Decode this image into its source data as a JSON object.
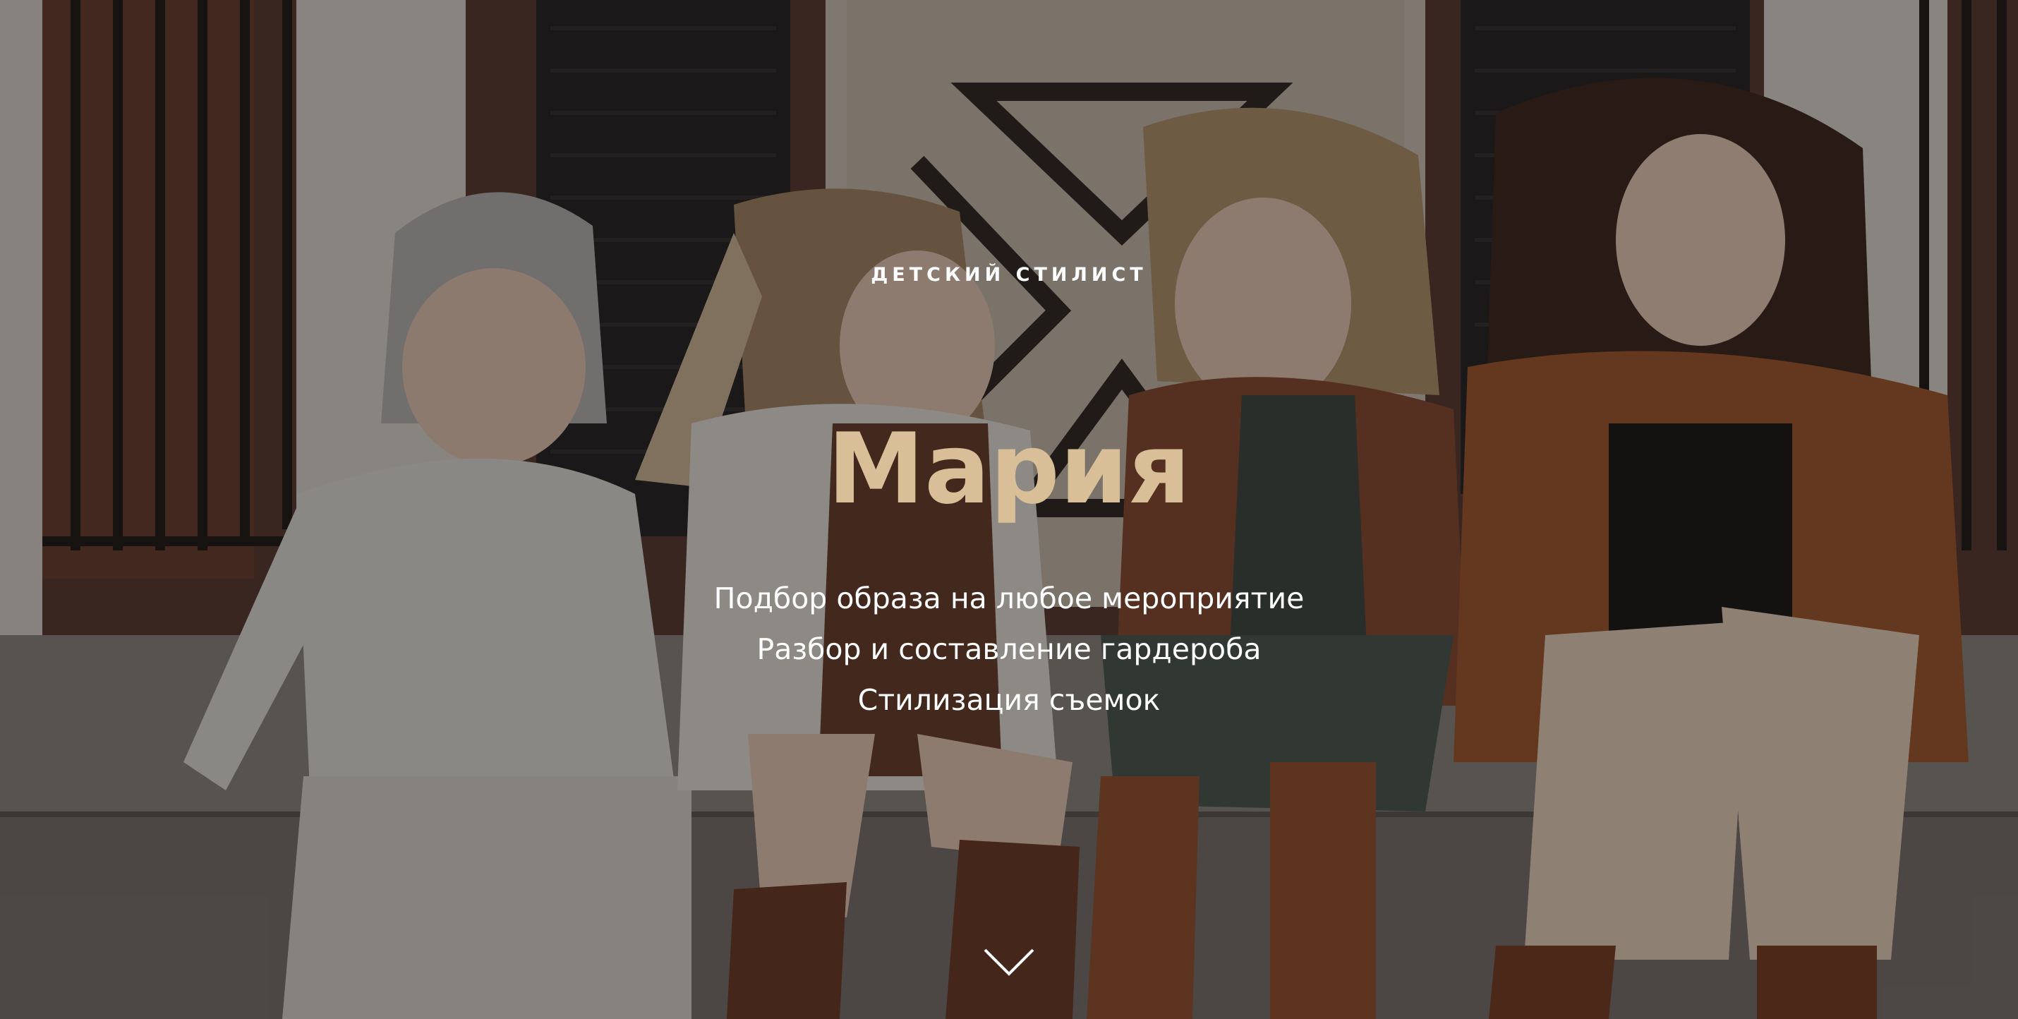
{
  "hero": {
    "eyebrow": "ДЕТСКИЙ СТИЛИСТ",
    "title": "Мария",
    "services": [
      "Подбор образа на любое мероприятие",
      "Разбор и составление гардероба",
      "Стилизация съемок"
    ],
    "scroll_icon": "chevron-down-icon"
  },
  "colors": {
    "title": "#d9bf98",
    "text": "#ffffff",
    "overlay": "#14100e"
  }
}
